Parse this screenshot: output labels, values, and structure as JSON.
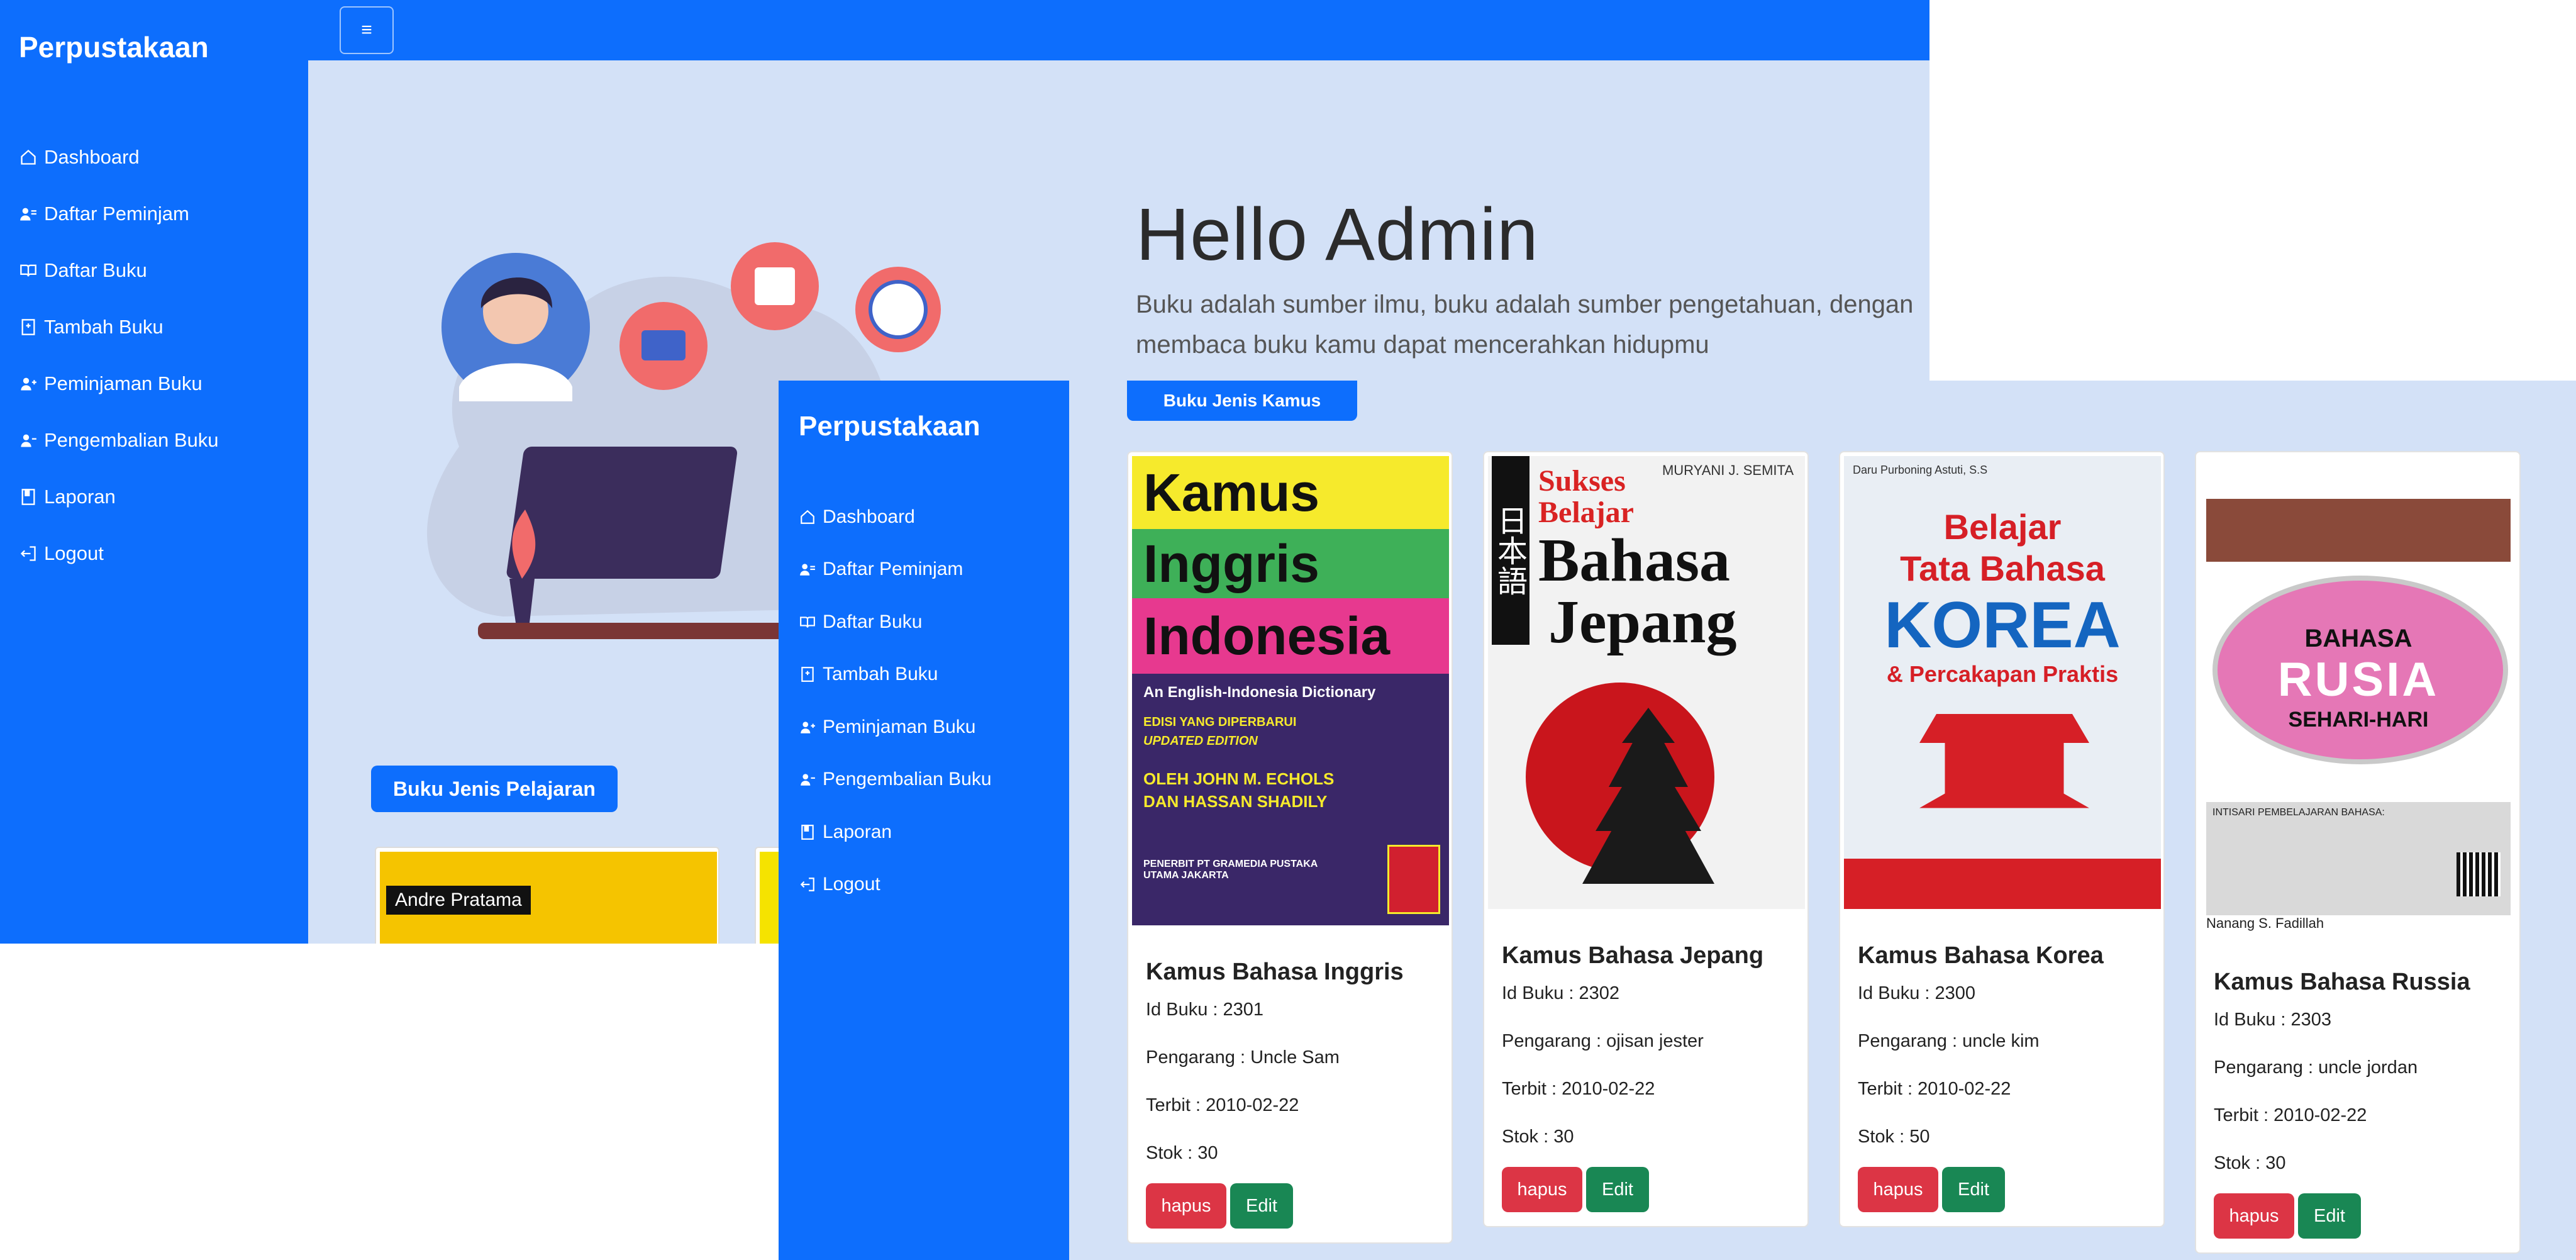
{
  "back_window": {
    "brand": "Perpustakaan",
    "nav": [
      {
        "icon": "home-icon",
        "label": "Dashboard"
      },
      {
        "icon": "users-icon",
        "label": "Daftar Peminjam"
      },
      {
        "icon": "book-open-icon",
        "label": "Daftar Buku"
      },
      {
        "icon": "bookmark-plus-icon",
        "label": "Tambah Buku"
      },
      {
        "icon": "user-plus-icon",
        "label": "Peminjaman Buku"
      },
      {
        "icon": "user-minus-icon",
        "label": "Pengembalian Buku"
      },
      {
        "icon": "journal-icon",
        "label": "Laporan"
      },
      {
        "icon": "logout-icon",
        "label": "Logout"
      }
    ],
    "toggler": "≡",
    "hero": {
      "title": "Hello Admin",
      "lead_line1": "Buku adalah sumber ilmu, buku adalah sumber pengetahuan, dengan",
      "lead_line2": "membaca buku kamu dapat mencerahkan hidupmu"
    },
    "section_button": "Buku Jenis Pelajaran",
    "peek_card_tag": "Andre Pratama"
  },
  "front_window": {
    "brand": "Perpustakaan",
    "nav": [
      {
        "icon": "home-icon",
        "label": "Dashboard"
      },
      {
        "icon": "users-icon",
        "label": "Daftar Peminjam"
      },
      {
        "icon": "book-open-icon",
        "label": "Daftar Buku"
      },
      {
        "icon": "bookmark-plus-icon",
        "label": "Tambah Buku"
      },
      {
        "icon": "user-plus-icon",
        "label": "Peminjaman Buku"
      },
      {
        "icon": "user-minus-icon",
        "label": "Pengembalian Buku"
      },
      {
        "icon": "journal-icon",
        "label": "Laporan"
      },
      {
        "icon": "logout-icon",
        "label": "Logout"
      }
    ],
    "section_button": "Buku Jenis Kamus",
    "books": [
      {
        "title": "Kamus Bahasa Inggris",
        "id": "Id Buku : 2301",
        "author": "Pengarang : Uncle Sam",
        "published": "Terbit : 2010-02-22",
        "stock": "Stok : 30",
        "delete": "hapus",
        "edit": "Edit",
        "cover": {
          "l1": "Kamus",
          "l2": "Inggris",
          "l3": "Indonesia",
          "sub": "An English-Indonesia Dictionary",
          "ed1": "EDISI YANG DIPERBARUI",
          "ed2": "UPDATED EDITION",
          "a1": "OLEH JOHN M. ECHOLS",
          "a2": "DAN HASSAN SHADILY",
          "pub": "PENERBIT PT GRAMEDIA PUSTAKA UTAMA JAKARTA"
        }
      },
      {
        "title": "Kamus Bahasa Jepang",
        "id": "Id Buku : 2302",
        "author": "Pengarang : ojisan jester",
        "published": "Terbit : 2010-02-22",
        "stock": "Stok : 30",
        "delete": "hapus",
        "edit": "Edit",
        "cover": {
          "author": "MURYANI J. SEMITA",
          "s1": "Sukses",
          "s2": "Belajar",
          "m1": "Bahasa",
          "m2": "Jepang",
          "jp": "日本語"
        }
      },
      {
        "title": "Kamus Bahasa Korea",
        "id": "Id Buku : 2300",
        "author": "Pengarang : uncle kim",
        "published": "Terbit : 2010-02-22",
        "stock": "Stok : 50",
        "delete": "hapus",
        "edit": "Edit",
        "cover": {
          "author": "Daru Purboning Astuti, S.S",
          "l1": "Belajar",
          "l2": "Tata Bahasa",
          "l3": "KOREA",
          "l4": "& Percakapan Praktis"
        }
      },
      {
        "title": "Kamus Bahasa Russia",
        "id": "Id Buku : 2303",
        "author": "Pengarang : uncle jordan",
        "published": "Terbit : 2010-02-22",
        "stock": "Stok : 30",
        "delete": "hapus",
        "edit": "Edit",
        "cover": {
          "l1": "BAHASA",
          "l2": "RUSIA",
          "l3": "SEHARI-HARI",
          "box": "INTISARI PEMBELAJARAN BAHASA:",
          "author": "Nanang S. Fadillah"
        }
      }
    ]
  }
}
